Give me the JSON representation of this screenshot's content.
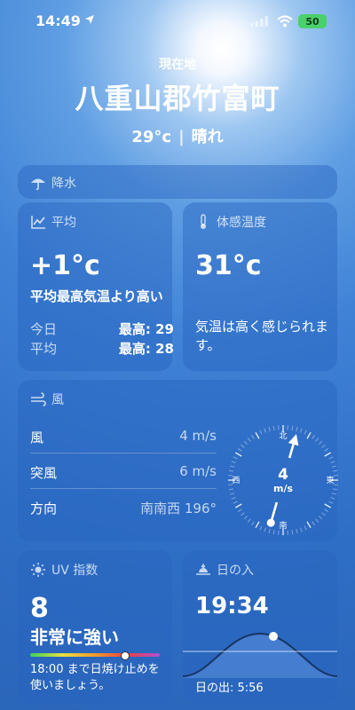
{
  "status_bar": {
    "time": "14:49",
    "battery": "50"
  },
  "header": {
    "current_label": "現在地",
    "city": "八重山郡竹富町",
    "temperature": "29°c",
    "condition": "晴れ"
  },
  "precipitation": {
    "title": "降水"
  },
  "average": {
    "title": "平均",
    "value": "+1°c",
    "description": "平均最高気温より高い",
    "today_label": "今日",
    "today_value": "最高: 29",
    "avg_label": "平均",
    "avg_value": "最高: 28"
  },
  "feels_like": {
    "title": "体感温度",
    "value": "31°c",
    "description": "気温は高く感じられます。"
  },
  "wind": {
    "title": "風",
    "rows": [
      {
        "label": "風",
        "value": "4 m/s"
      },
      {
        "label": "突風",
        "value": "6 m/s"
      },
      {
        "label": "方向",
        "value": "南南西 196°"
      }
    ],
    "compass": {
      "north": "北",
      "south": "南",
      "east": "東",
      "west": "西",
      "speed": "4",
      "unit": "m/s",
      "direction_deg": 196
    }
  },
  "uv": {
    "title": "UV 指数",
    "value": "8",
    "level": "非常に強い",
    "level_fraction": 0.73,
    "description": "18:00 まで日焼け止めを使いましょう。"
  },
  "sunset": {
    "title": "日の入",
    "time": "19:34",
    "sunrise": "日の出: 5:56"
  },
  "colors": {
    "uv_low": "#3bd15b",
    "uv_high": "#b04fd6",
    "battery": "#49d16a"
  }
}
